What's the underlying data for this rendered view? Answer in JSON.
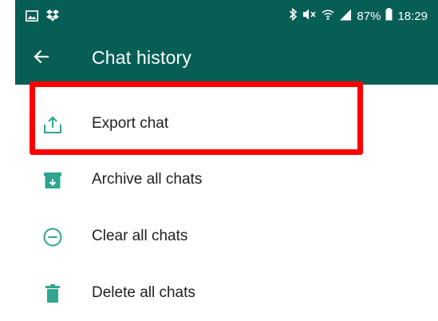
{
  "status_bar": {
    "battery_percent": "87%",
    "time": "18:29",
    "left_icons": [
      "gallery-icon",
      "dropbox-icon"
    ],
    "right_icons": [
      "bluetooth-icon",
      "mute-icon",
      "wifi-icon",
      "signal-icon",
      "battery-icon"
    ]
  },
  "app_bar": {
    "title": "Chat history",
    "back_icon": "arrow-back-icon",
    "color": "#075e54"
  },
  "menu": {
    "items": [
      {
        "label": "Export chat",
        "icon": "export-icon"
      },
      {
        "label": "Archive all chats",
        "icon": "archive-icon"
      },
      {
        "label": "Clear all chats",
        "icon": "clear-icon"
      },
      {
        "label": "Delete all chats",
        "icon": "delete-icon"
      }
    ]
  },
  "colors": {
    "accent": "#075e54",
    "icon_teal": "#2fa58f",
    "highlight": "#ff0000"
  }
}
